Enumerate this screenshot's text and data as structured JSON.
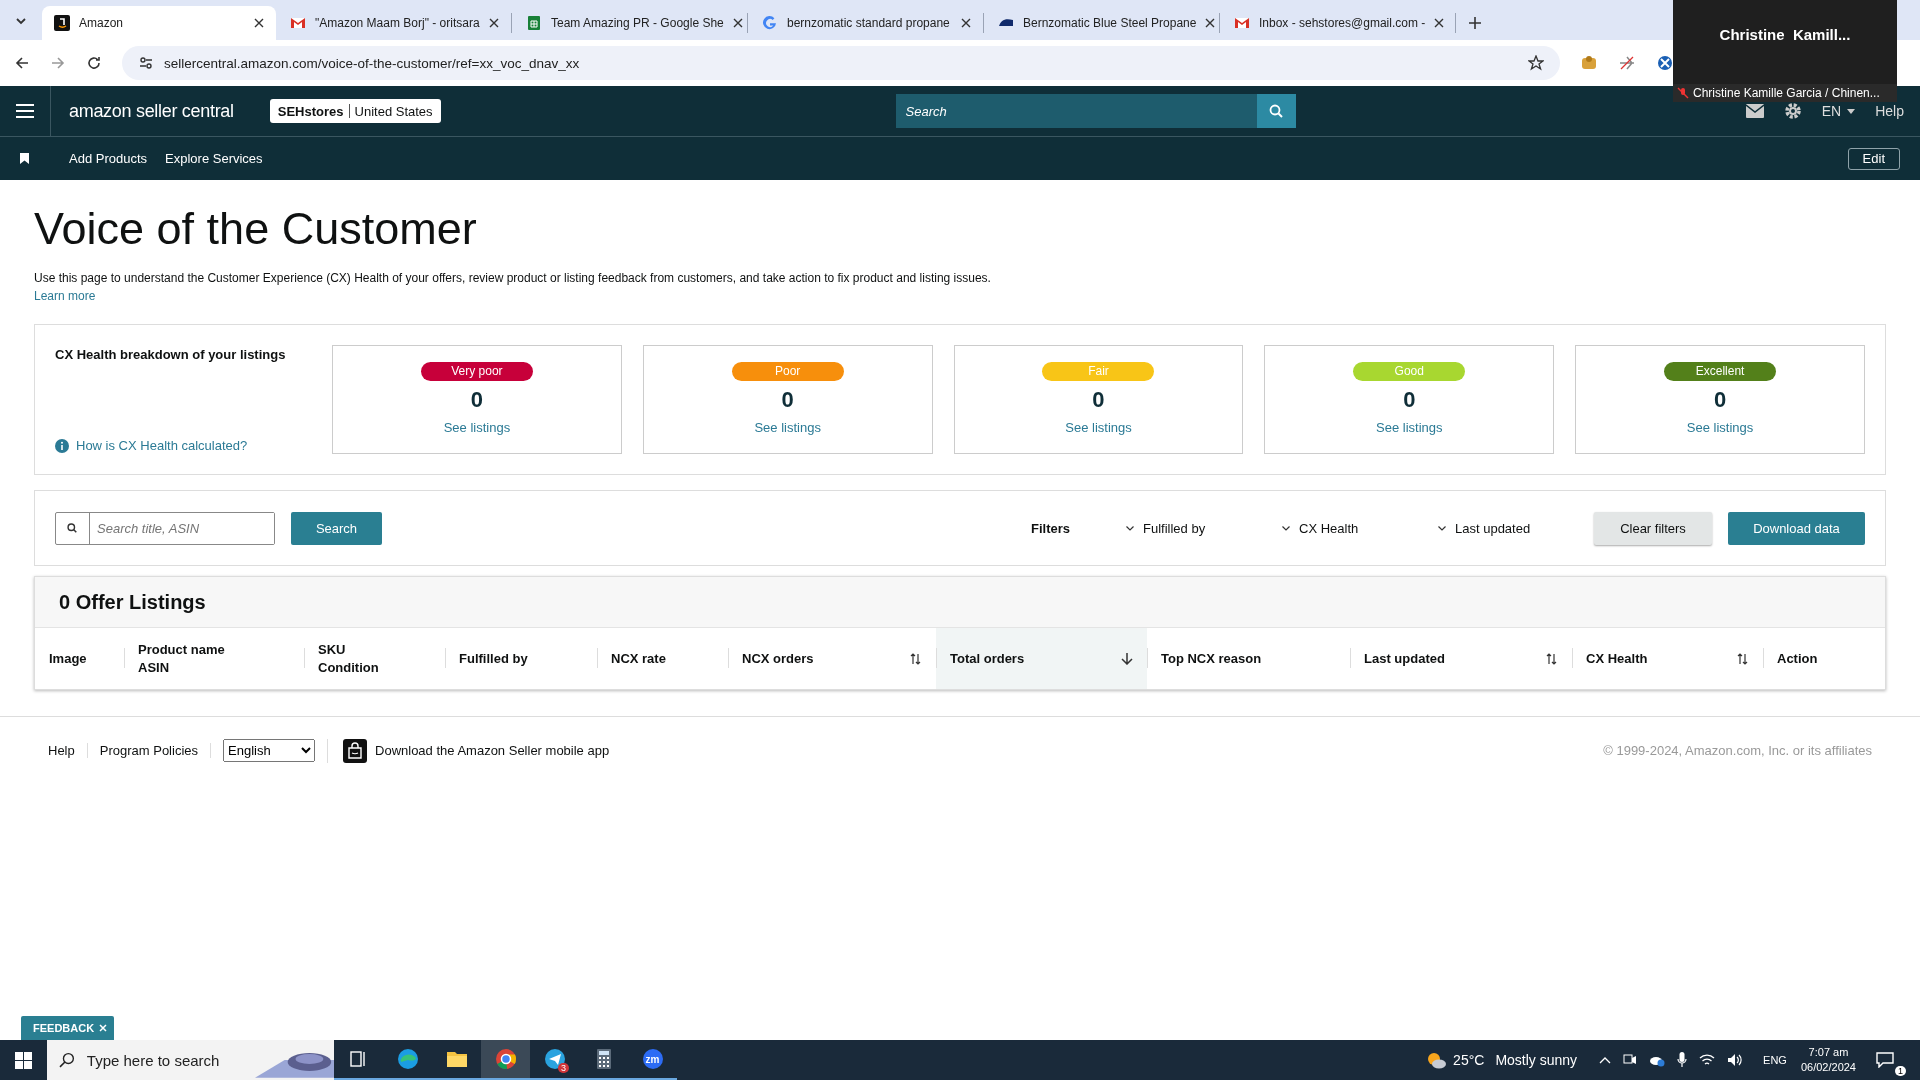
{
  "browser": {
    "tabs": [
      {
        "kind": "amazon",
        "title": "Amazon",
        "selected": true
      },
      {
        "kind": "gmail",
        "title": "\"Amazon Maam Borj\" - oritsara",
        "selected": false
      },
      {
        "kind": "sheets",
        "title": "Team Amazing PR - Google She",
        "selected": false
      },
      {
        "kind": "google",
        "title": "bernzomatic standard propane",
        "selected": false
      },
      {
        "kind": "brand",
        "title": "Bernzomatic Blue Steel Propane",
        "selected": false
      },
      {
        "kind": "gmail",
        "title": "Inbox - sehstores@gmail.com -",
        "selected": false
      }
    ],
    "url": "sellercentral.amazon.com/voice-of-the-customer/ref=xx_voc_dnav_xx"
  },
  "call_overlay": {
    "name": "Christine  Kamill...",
    "caption": "Christine Kamille Garcia / Chinen..."
  },
  "header": {
    "logo": "amazon seller central",
    "store": "SEHstores",
    "region": "United States",
    "search_placeholder": "Search",
    "language": "EN",
    "help": "Help"
  },
  "nav": {
    "links": [
      "Add Products",
      "Explore Services"
    ],
    "edit": "Edit"
  },
  "page": {
    "title": "Voice of the Customer",
    "description": "Use this page to understand the Customer Experience (CX) Health of your offers, review product or listing feedback from customers, and take action to fix product and listing issues.",
    "learn_more": "Learn more"
  },
  "cx_health": {
    "title": "CX Health breakdown of your listings",
    "help_link": "How is CX Health calculated?",
    "buckets": [
      {
        "label": "Very poor",
        "color": "#c7003a",
        "count": "0",
        "link": "See listings"
      },
      {
        "label": "Poor",
        "color": "#f78f0c",
        "count": "0",
        "link": "See listings"
      },
      {
        "label": "Fair",
        "color": "#f8c517",
        "count": "0",
        "link": "See listings"
      },
      {
        "label": "Good",
        "color": "#a8d730",
        "count": "0",
        "link": "See listings"
      },
      {
        "label": "Excellent",
        "color": "#53801a",
        "count": "0",
        "link": "See listings"
      }
    ]
  },
  "toolbar": {
    "search_placeholder": "Search title, ASIN",
    "search_button": "Search",
    "filters_label": "Filters",
    "filters": [
      "Fulfilled by",
      "CX Health",
      "Last updated"
    ],
    "clear_button": "Clear filters",
    "download_button": "Download data"
  },
  "listings": {
    "title": "0 Offer Listings",
    "columns": [
      {
        "lines": [
          "Image"
        ],
        "sortable": false,
        "sorted": false
      },
      {
        "lines": [
          "Product name",
          "ASIN"
        ],
        "sortable": false,
        "sorted": false
      },
      {
        "lines": [
          "SKU",
          "Condition"
        ],
        "sortable": false,
        "sorted": false
      },
      {
        "lines": [
          "Fulfilled by"
        ],
        "sortable": false,
        "sorted": false
      },
      {
        "lines": [
          "NCX rate"
        ],
        "sortable": false,
        "sorted": false
      },
      {
        "lines": [
          "NCX orders"
        ],
        "sortable": true,
        "sorted": false
      },
      {
        "lines": [
          "Total orders"
        ],
        "sortable": true,
        "sorted": true
      },
      {
        "lines": [
          "Top NCX reason"
        ],
        "sortable": false,
        "sorted": false
      },
      {
        "lines": [
          "Last updated"
        ],
        "sortable": true,
        "sorted": false
      },
      {
        "lines": [
          "CX Health"
        ],
        "sortable": true,
        "sorted": false
      },
      {
        "lines": [
          "Action"
        ],
        "sortable": false,
        "sorted": false
      }
    ]
  },
  "footer": {
    "links": [
      "Help",
      "Program Policies"
    ],
    "language": "English",
    "app_link": "Download the Amazon Seller mobile app",
    "copyright": "© 1999-2024, Amazon.com, Inc. or its affiliates"
  },
  "feedback": "FEEDBACK",
  "taskbar": {
    "search_placeholder": "Type here to search",
    "apps": [
      {
        "kind": "taskview",
        "selected": false
      },
      {
        "kind": "edge",
        "selected": false
      },
      {
        "kind": "explorer",
        "selected": false
      },
      {
        "kind": "chrome",
        "selected": true
      },
      {
        "kind": "telegram",
        "selected": false,
        "badge": "3"
      },
      {
        "kind": "calculator",
        "selected": false
      },
      {
        "kind": "zoom",
        "selected": false,
        "logo_text": "zm"
      }
    ],
    "temperature": "25°C",
    "weather": "Mostly sunny",
    "language": "ENG",
    "time": "7:07 am",
    "date": "06/02/2024",
    "notifications": "1"
  }
}
